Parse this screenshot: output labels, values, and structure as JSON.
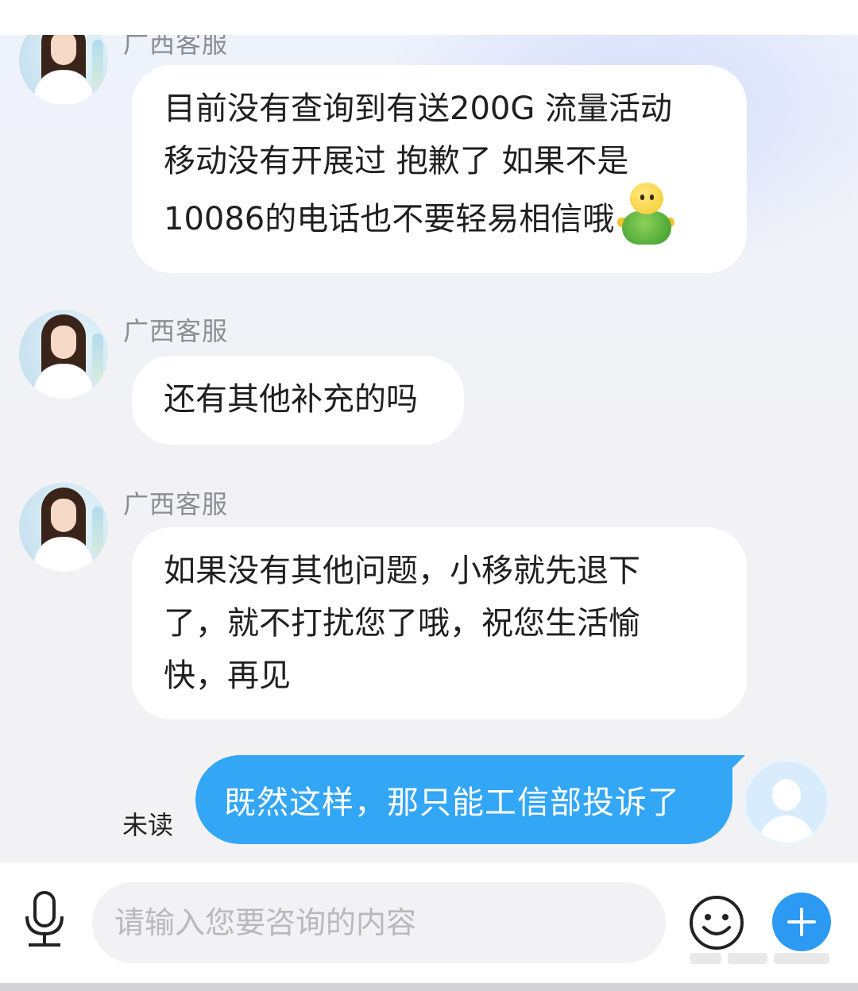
{
  "messages": [
    {
      "sender": "广西客服",
      "lines": [
        "目前没有查询到有送200G 流量活动",
        "移动没有开展过 抱歉了 如果不是",
        "10086的电话也不要轻易相信哦"
      ],
      "emoji": "turtle-emoji"
    },
    {
      "sender": "广西客服",
      "lines": [
        "还有其他补充的吗"
      ]
    },
    {
      "sender": "广西客服",
      "lines": [
        "如果没有其他问题，小移就先退下",
        "了，就不打扰您了哦，祝您生活愉",
        "快，再见"
      ]
    }
  ],
  "outgoing": {
    "text": "既然这样，那只能工信部投诉了",
    "status": "未读"
  },
  "composer": {
    "placeholder": "请输入您要咨询的内容"
  },
  "icons": {
    "voice": "microphone-icon",
    "emoji": "smiley-icon",
    "more": "plus-icon"
  },
  "colors": {
    "outgoing_bubble": "#33a6f6",
    "plus_button": "#2c9af2",
    "sender_text": "#8a8d93"
  }
}
